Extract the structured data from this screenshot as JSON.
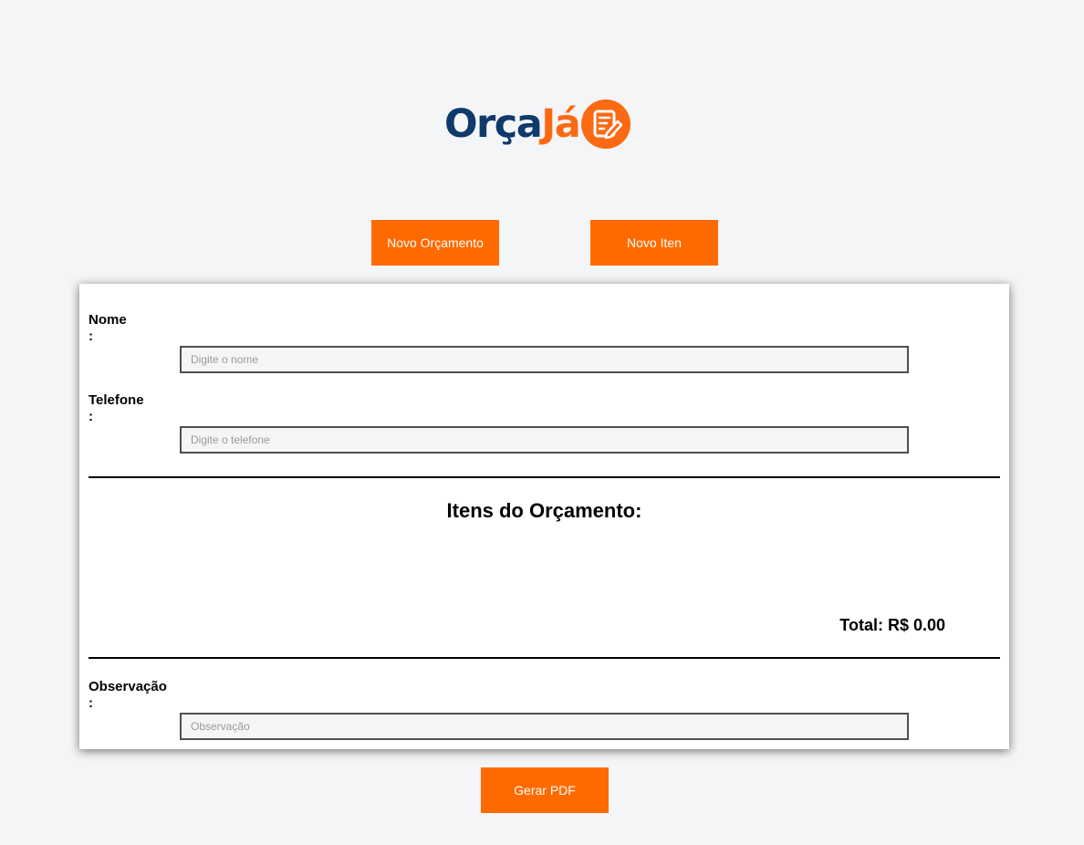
{
  "brand": {
    "name_part1": "Orça",
    "name_part2": "Já",
    "primary_color": "#0f3a6b",
    "accent_color": "#fb6a13",
    "icon": "edit-document-icon"
  },
  "toolbar": {
    "novo_orcamento_label": "Novo Orçamento",
    "novo_item_label": "Novo Iten"
  },
  "form": {
    "nome": {
      "label": "Nome",
      "colon": ":",
      "placeholder": "Digite o nome",
      "value": ""
    },
    "telefone": {
      "label": "Telefone",
      "colon": ":",
      "placeholder": "Digite o telefone",
      "value": ""
    },
    "observacao": {
      "label": "Observação",
      "colon": ":",
      "placeholder": "Observação",
      "value": ""
    }
  },
  "itens": {
    "title": "Itens do Orçamento:",
    "items": [],
    "total_label": "Total: R$ 0.00"
  },
  "actions": {
    "gerar_pdf_label": "Gerar PDF"
  },
  "colors": {
    "button": "#ff6a00",
    "background": "#f4f5f7",
    "card": "#ffffff"
  }
}
